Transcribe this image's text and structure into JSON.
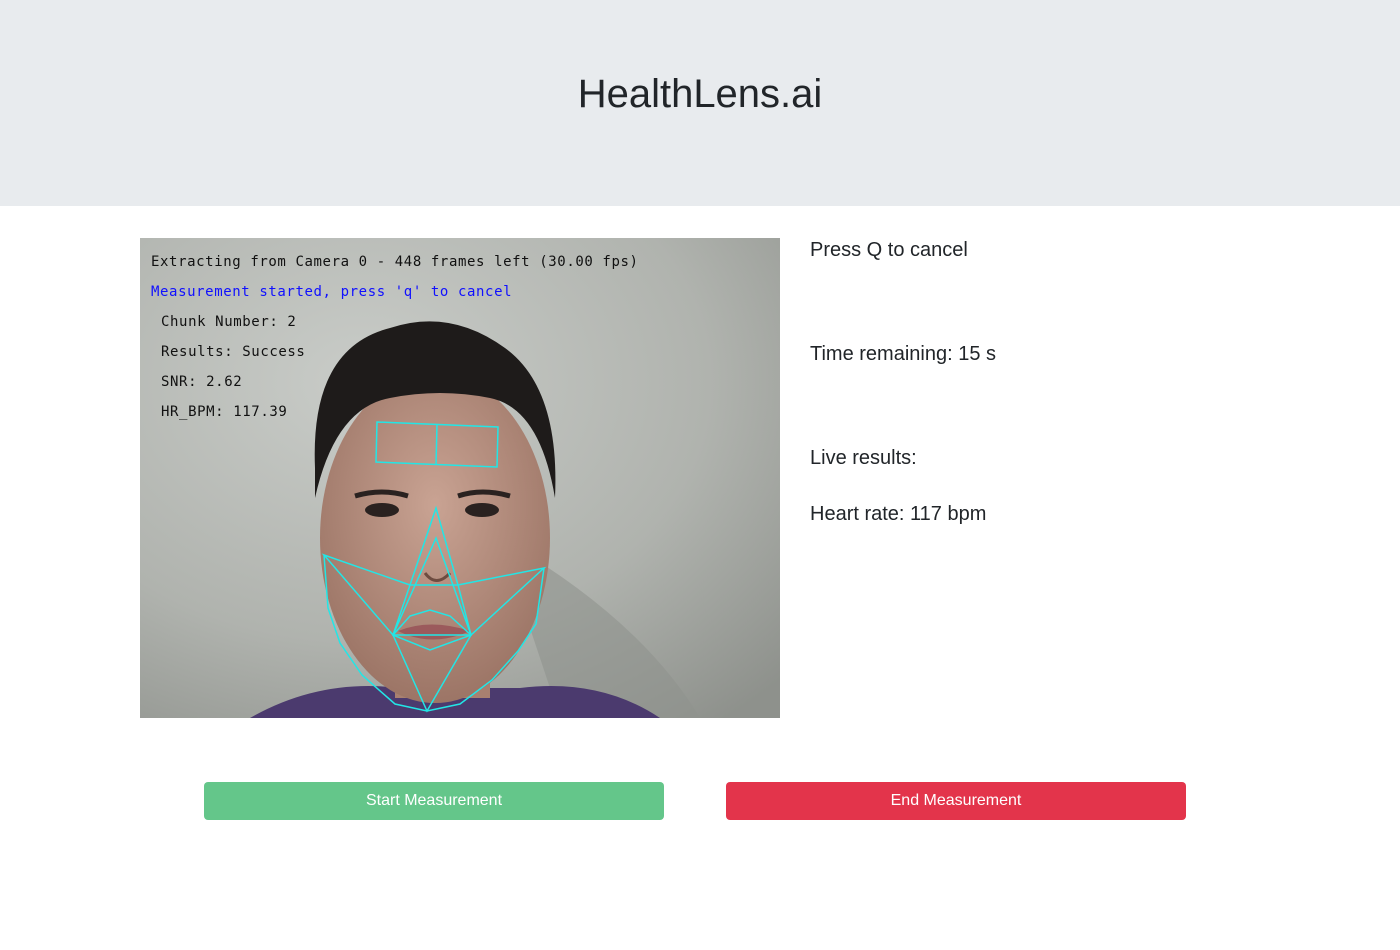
{
  "header": {
    "title": "HealthLens.ai"
  },
  "camera": {
    "overlay": {
      "line1": "Extracting from Camera 0 - 448 frames left (30.00 fps)",
      "line2": "Measurement started, press 'q' to cancel",
      "chunk": "Chunk Number: 2",
      "results": "Results: Success",
      "snr": "SNR: 2.62",
      "hr": "HR_BPM: 117.39"
    },
    "overlay_text_color": "#111111",
    "status_text_color": "#1010ff",
    "landmark_color": "#22e6e6"
  },
  "info": {
    "cancel_hint": "Press Q to cancel",
    "time_remaining": "Time remaining: 15 s",
    "live_results_label": "Live results:",
    "heart_rate": "Heart rate: 117 bpm"
  },
  "buttons": {
    "start_label": "Start Measurement",
    "end_label": "End Measurement",
    "start_color": "#64c68a",
    "end_color": "#e3344b"
  }
}
